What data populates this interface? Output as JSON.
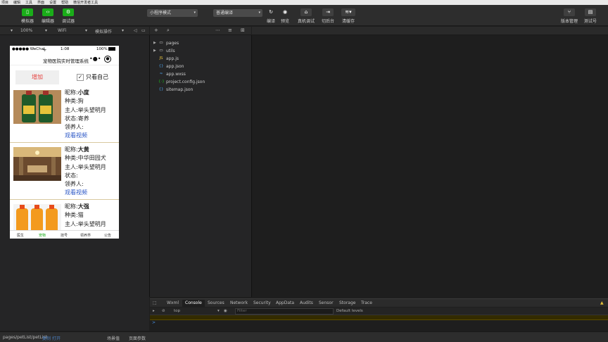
{
  "menubar": [
    "项目",
    "编辑",
    "工具",
    "界面",
    "设置",
    "帮助",
    "微信开发者工具"
  ],
  "toolbar": {
    "simulator": "模拟器",
    "editor": "编辑器",
    "debugger": "调试器",
    "mode_select": "小程序模式",
    "compile_select": "普通编译",
    "compile": "编译",
    "preview": "预览",
    "device_debug": "真机调试",
    "background": "切后台",
    "clear_cache": "清缓存",
    "version": "版本管理",
    "test": "测试号"
  },
  "subbar": {
    "zoom": "100%",
    "network": "WiFi",
    "sim_op": "模拟操作"
  },
  "phone": {
    "carrier": "●●●●● WeChat",
    "time": "1:08",
    "battery": "100%",
    "nav_title": "宠物医院实时管理系统",
    "add_button": "增加",
    "only_mine": "只看自己",
    "check_mark": "✓",
    "labels": {
      "name": "昵称:",
      "type": "种类:",
      "owner": "主人:",
      "status": "状态:",
      "adopter": "领养人:",
      "video": "观看视频"
    },
    "pets": [
      {
        "name": "小度",
        "type": "狗",
        "owner": "举头望明月",
        "status": "寄养",
        "adopter": ""
      },
      {
        "name": "大黄",
        "type": "中华田园犬",
        "owner": "举头望明月",
        "status": "",
        "adopter": ""
      },
      {
        "name": "大强",
        "type": "猫",
        "owner": "举头望明月",
        "status": "",
        "adopter": ""
      }
    ],
    "tabs": [
      "医生",
      "宠物",
      "挂号",
      "领养界",
      "公告"
    ]
  },
  "files": [
    {
      "name": "pages",
      "kind": "folder"
    },
    {
      "name": "utils",
      "kind": "folder"
    },
    {
      "name": "app.js",
      "kind": "js"
    },
    {
      "name": "app.json",
      "kind": "json"
    },
    {
      "name": "app.wxss",
      "kind": "wxss"
    },
    {
      "name": "project.config.json",
      "kind": "config"
    },
    {
      "name": "sitemap.json",
      "kind": "json"
    }
  ],
  "devtools": {
    "tabs": [
      "Wxml",
      "Console",
      "Sources",
      "Network",
      "Security",
      "AppData",
      "Audits",
      "Sensor",
      "Storage",
      "Trace"
    ],
    "active_tab": "Console",
    "context": "top",
    "filter_placeholder": "Filter",
    "levels": "Default levels",
    "prompt": ">"
  },
  "statusbar": {
    "path": "pages/petList/petList",
    "copy": "复制",
    "open": "打开",
    "scene": "场景值",
    "params": "页面参数"
  },
  "colors": {
    "accent": "#1aad19",
    "link": "#2a56c6",
    "add_text": "#e64340"
  }
}
